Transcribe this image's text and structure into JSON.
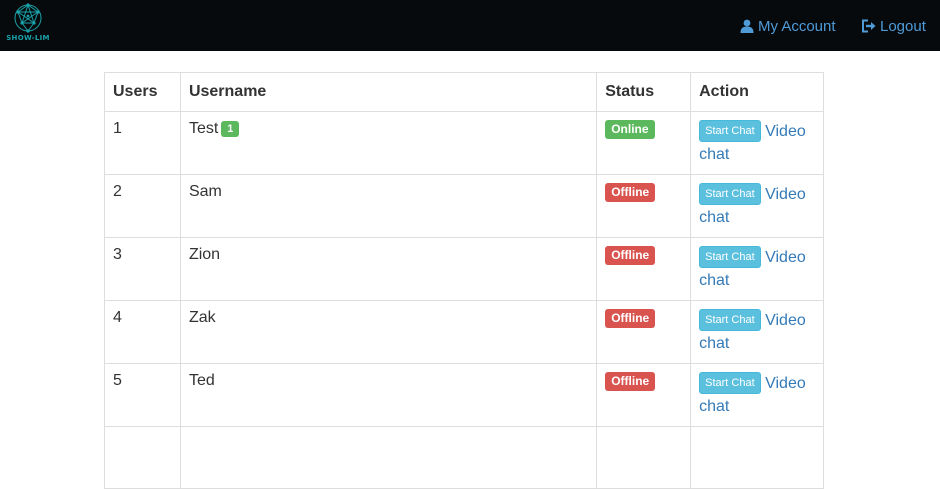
{
  "brand": {
    "name": "SHOW-LIM"
  },
  "nav": {
    "account_label": "My Account",
    "logout_label": "Logout"
  },
  "table": {
    "headers": {
      "users": "Users",
      "username": "Username",
      "status": "Status",
      "action": "Action"
    },
    "rows": [
      {
        "num": "1",
        "username": "Test",
        "badge": "1",
        "status": "Online",
        "start_chat": "Start Chat",
        "video": "Video chat"
      },
      {
        "num": "2",
        "username": "Sam",
        "badge": "",
        "status": "Offline",
        "start_chat": "Start Chat",
        "video": "Video chat"
      },
      {
        "num": "3",
        "username": "Zion",
        "badge": "",
        "status": "Offline",
        "start_chat": "Start Chat",
        "video": "Video chat"
      },
      {
        "num": "4",
        "username": "Zak",
        "badge": "",
        "status": "Offline",
        "start_chat": "Start Chat",
        "video": "Video chat"
      },
      {
        "num": "5",
        "username": "Ted",
        "badge": "",
        "status": "Offline",
        "start_chat": "Start Chat",
        "video": "Video chat"
      }
    ]
  },
  "colors": {
    "navbar": "#060a0d",
    "link": "#4f9bd8",
    "online": "#5cb85c",
    "offline": "#d9534f",
    "info_button": "#5bc0de"
  }
}
